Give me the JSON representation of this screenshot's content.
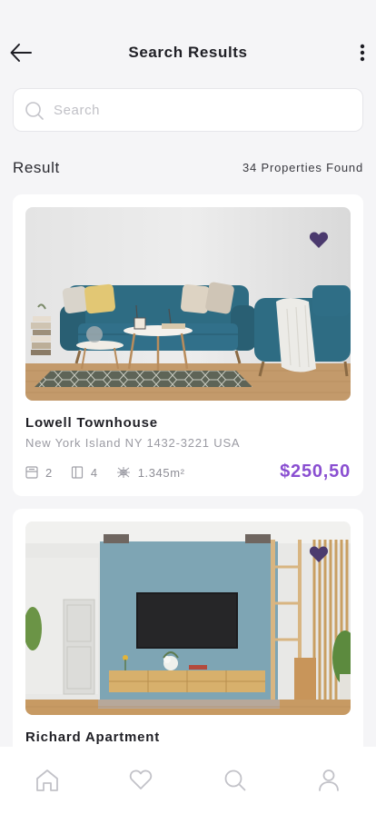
{
  "header": {
    "title": "Search Results"
  },
  "search": {
    "placeholder": "Search",
    "value": ""
  },
  "results": {
    "label": "Result",
    "count_text": "34 Properties Found"
  },
  "listings": [
    {
      "name": "Lowell Townhouse",
      "address": "New York Island NY 1432-3221 USA",
      "beds": "2",
      "baths": "4",
      "area": "1.345m²",
      "price": "$250,50",
      "favorited": true
    },
    {
      "name": "Richard Apartment",
      "favorited": true
    }
  ],
  "nav": {
    "items": [
      "home-icon",
      "heart-icon",
      "search-icon",
      "user-icon"
    ]
  },
  "colors": {
    "accent": "#8a4fd1",
    "favorite": "#4b3a6e",
    "background": "#f5f5f7"
  }
}
